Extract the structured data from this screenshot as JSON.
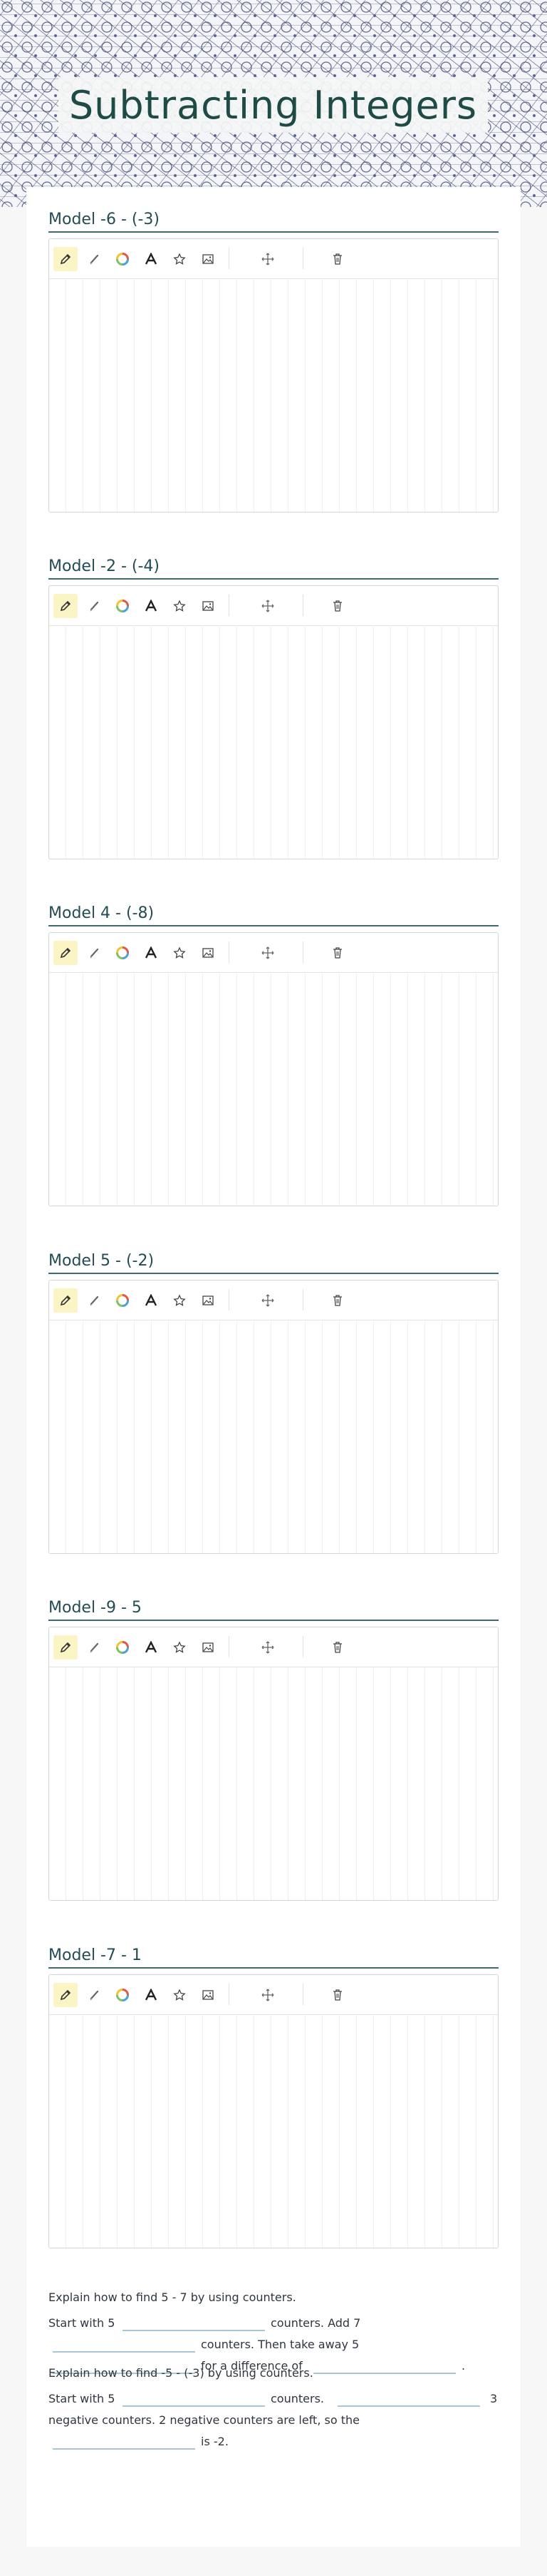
{
  "header": {
    "title": "Subtracting Integers"
  },
  "models": [
    {
      "title": "Model -6 - (-3)"
    },
    {
      "title": "Model -2 - (-4)"
    },
    {
      "title": "Model 4 - (-8)"
    },
    {
      "title": "Model 5 - (-2)"
    },
    {
      "title": "Model -9 - 5"
    },
    {
      "title": "Model -7 - 1"
    }
  ],
  "toolbar_icons": [
    "pencil-icon",
    "highlighter-icon",
    "color-wheel-icon",
    "text-icon",
    "star-icon",
    "image-icon",
    "move-icon",
    "trash-icon"
  ],
  "colors": {
    "active_tool": "#fbf4c5",
    "title_text": "#1f4b46",
    "rule": "#3d6b6e"
  },
  "question1": {
    "prompt": "Explain how to find 5 - 7 by using counters.",
    "start": "Start with 5",
    "p1": "counters. Add 7",
    "p2": "counters. Then take away 5",
    "p3": "for a difference of",
    "end": "."
  },
  "question2": {
    "prompt": "Explain how to find -5 - (-3) by using counters.",
    "start": "Start with 5",
    "p1": "counters.",
    "p2": "3",
    "line2": "negative counters. 2 negative counters are left, so the",
    "p3": "is -2."
  }
}
